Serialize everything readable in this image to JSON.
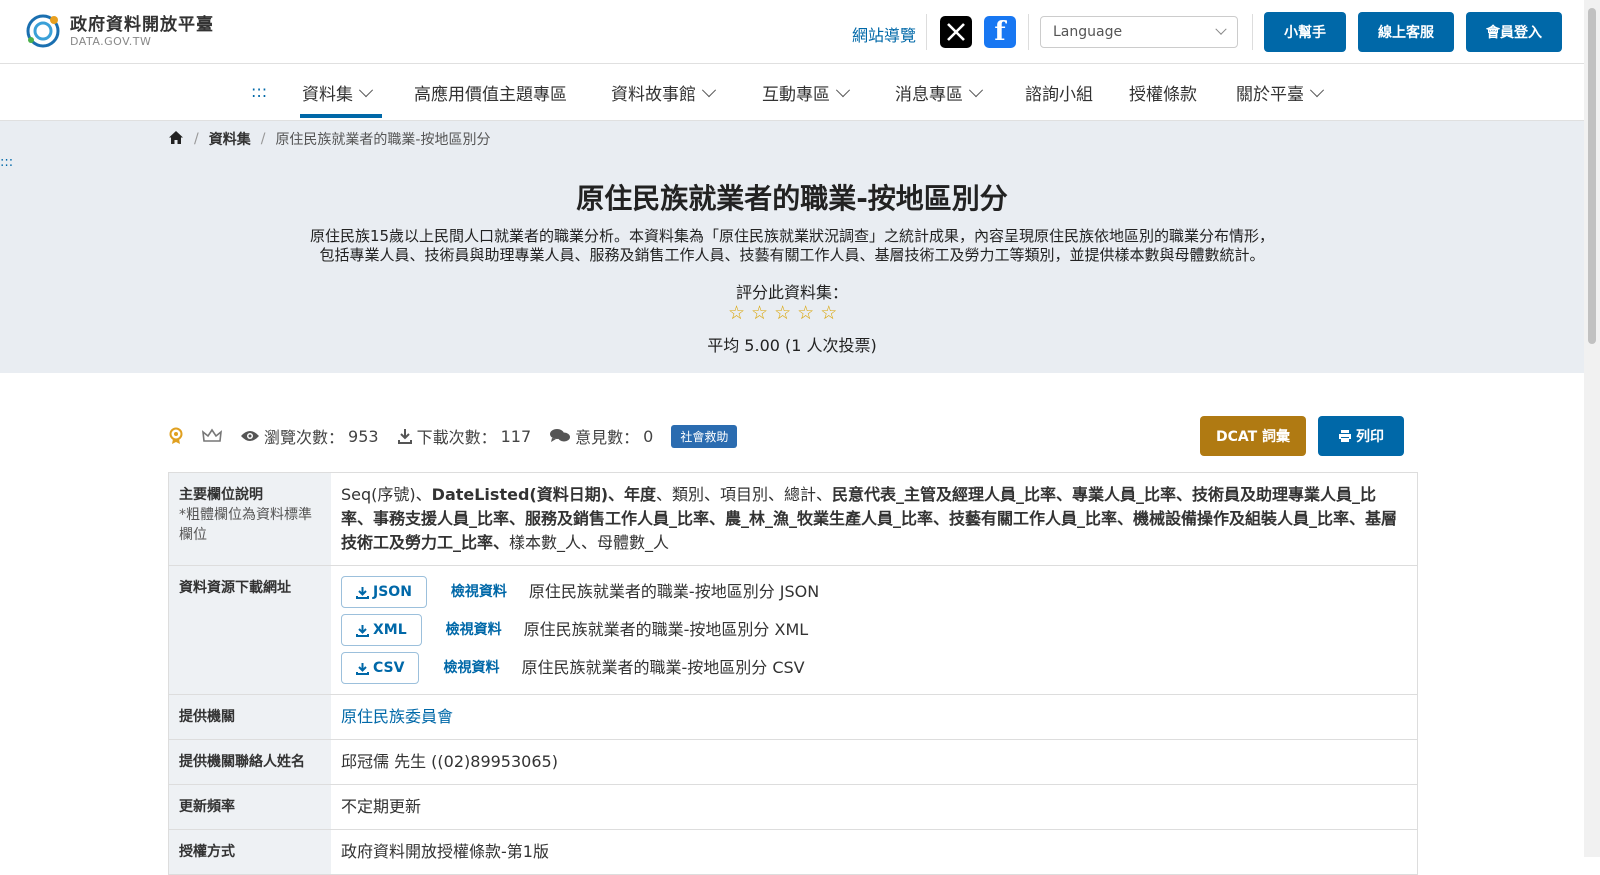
{
  "header": {
    "logo_title": "政府資料開放平臺",
    "logo_sub": "DATA.GOV.TW",
    "sitemap": "網站導覽",
    "language_placeholder": "Language",
    "buttons": {
      "helper": "小幫手",
      "service": "線上客服",
      "login": "會員登入"
    },
    "social": [
      "x-icon",
      "facebook-icon"
    ]
  },
  "nav": {
    "dots": ":::",
    "items": [
      {
        "label": "資料集",
        "dropdown": true,
        "active": true
      },
      {
        "label": "高應用價值主題專區",
        "dropdown": false
      },
      {
        "label": "資料故事館",
        "dropdown": true
      },
      {
        "label": "互動專區",
        "dropdown": true
      },
      {
        "label": "消息專區",
        "dropdown": true
      },
      {
        "label": "諮詢小組",
        "dropdown": false
      },
      {
        "label": "授權條款",
        "dropdown": false
      },
      {
        "label": "關於平臺",
        "dropdown": true
      }
    ]
  },
  "breadcrumb": {
    "home": "home-icon",
    "level1": "資料集",
    "current": "原住民族就業者的職業-按地區別分"
  },
  "hero": {
    "side_dots": ":::",
    "title": "原住民族就業者的職業-按地區別分",
    "desc_line1": "原住民族15歲以上民間人口就業者的職業分析。本資料集為「原住民族就業狀況調查」之統計成果，內容呈現原住民族依地區別的職業分布情形，",
    "desc_line2": "包括專業人員、技術員與助理專業人員、服務及銷售工作人員、技藝有關工作人員、基層技術工及勞力工等類別，並提供樣本數與母體數統計。",
    "rate_label": "評分此資料集：",
    "stars": [
      "☆",
      "☆",
      "☆",
      "☆",
      "☆"
    ],
    "avg": "平均 5.00 (1 人次投票)"
  },
  "stats": {
    "views_label": "瀏覽次數：",
    "views": "953",
    "downloads_label": "下載次數：",
    "downloads": "117",
    "comments_label": "意見數：",
    "comments": "0",
    "tag": "社會救助",
    "dcat": "DCAT 詞彙",
    "print": "列印"
  },
  "table": {
    "fields_label": "主要欄位說明",
    "fields_note": "*粗體欄位為資料標準欄位",
    "fields": [
      {
        "t": "Seq(序號)、",
        "b": false
      },
      {
        "t": "DateListed(資料日期)、年度",
        "b": true
      },
      {
        "t": "、類別、項目別、總計、",
        "b": false
      },
      {
        "t": "民意代表_主管及經理人員_比率、專業人員_比率、技術員及助理專業人員_比率、事務支援人員_比率、服務及銷售工作人員_比率、農_林_漁_牧業生產人員_比率、技藝有關工作人員_比率、機械設備操作及組裝人員_比率、基層技術工及勞力工_比率、",
        "b": true
      },
      {
        "t": "樣本數_人、母體數_人",
        "b": false
      }
    ],
    "resources_label": "資料資源下載網址",
    "resources": [
      {
        "format": "JSON",
        "view": "檢視資料",
        "name": "原住民族就業者的職業-按地區別分 JSON"
      },
      {
        "format": "XML",
        "view": "檢視資料",
        "name": "原住民族就業者的職業-按地區別分 XML"
      },
      {
        "format": "CSV",
        "view": "檢視資料",
        "name": "原住民族就業者的職業-按地區別分 CSV"
      }
    ],
    "agency_label": "提供機關",
    "agency": "原住民族委員會",
    "contact_label": "提供機關聯絡人姓名",
    "contact": "邱冠儒 先生 ((02)89953065)",
    "freq_label": "更新頻率",
    "freq": "不定期更新",
    "license_label": "授權方式",
    "license": "政府資料開放授權條款-第1版"
  }
}
